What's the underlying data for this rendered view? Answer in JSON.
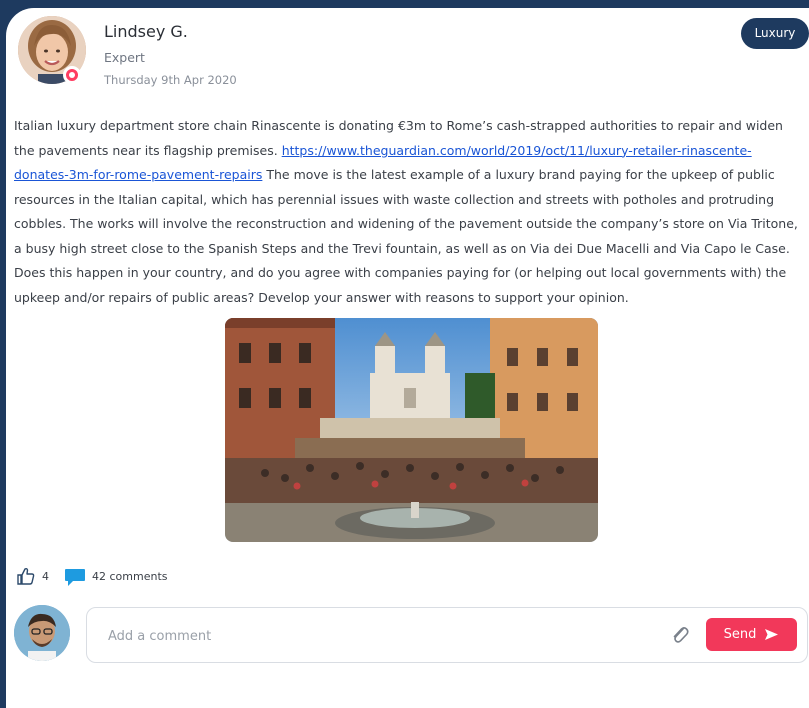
{
  "post": {
    "author": {
      "name": "Lindsey G.",
      "role": "Expert",
      "date": "Thursday 9th Apr 2020"
    },
    "tag": "Luxury",
    "body": {
      "text_before_link": "Italian luxury department store chain Rinascente is donating €3m to Rome’s cash-strapped authorities to repair and widen the pavements near its flagship premises. ",
      "link": "https://www.theguardian.com/world/2019/oct/11/luxury-retailer-rinascente-donates-3m-for-rome-pavement-repairs",
      "text_after_link": " The move is the latest example of a luxury brand paying for the upkeep of public resources in the Italian capital, which has perennial issues with waste collection and streets with potholes and protruding cobbles. The works will involve the reconstruction and widening of the pavement outside the company’s store on Via Tritone, a busy high street close to the Spanish Steps and the Trevi fountain, as well as on Via dei Due Macelli and Via Capo le Case. Does this happen in your country, and do you agree with companies paying for (or helping out local governments with) the upkeep and/or repairs of public areas? Develop your answer with reasons to support your opinion."
    },
    "stats": {
      "likes": "4",
      "comments": "42 comments"
    }
  },
  "composer": {
    "placeholder": "Add a comment",
    "send_label": "Send"
  },
  "colors": {
    "navy": "#1e3a5f",
    "accent": "#f2385a",
    "link": "#1a55d6",
    "comment_icon": "#1e9be0"
  },
  "icons": [
    "thumbs-up-icon",
    "comment-bubble-icon",
    "paperclip-icon",
    "send-arrow-icon"
  ]
}
